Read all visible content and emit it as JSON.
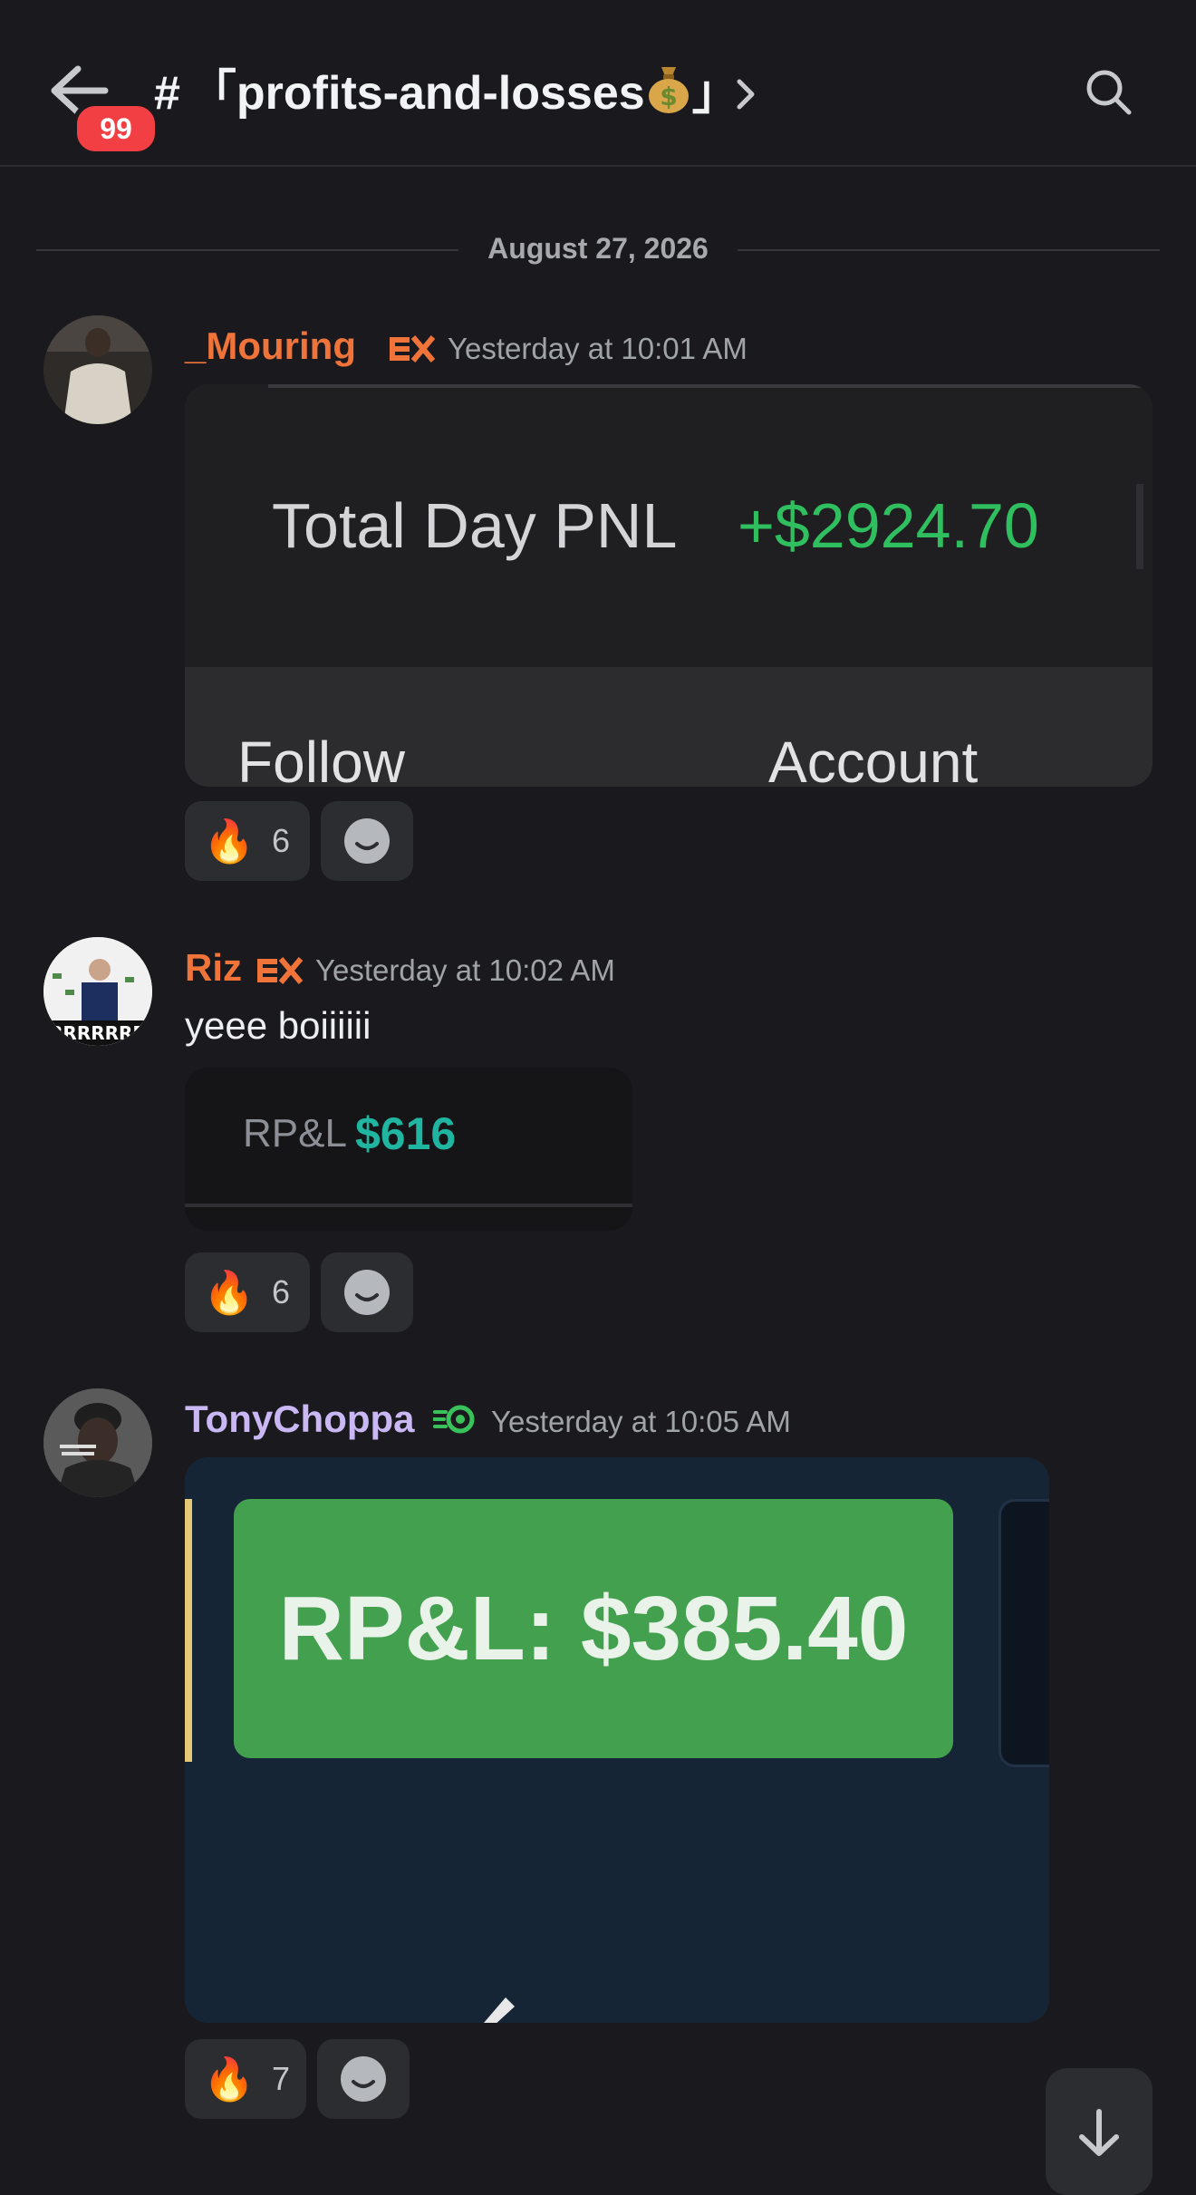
{
  "header": {
    "unread_badge": "99",
    "channel_hash": "#",
    "channel_name": "「profits-and-losses",
    "channel_suffix": "」"
  },
  "date_divider": "August 27, 2026",
  "messages": [
    {
      "author": "_Mouring",
      "author_color": "#f0743a",
      "tag": "EX",
      "timestamp": "Yesterday at 10:01 AM",
      "image": {
        "label": "Total Day PNL",
        "value": "+$2924.70",
        "footer_left": "Follow",
        "footer_right": "Account"
      },
      "reaction": {
        "emoji": "🔥",
        "count": "6"
      }
    },
    {
      "author": "Riz",
      "author_color": "#f0743a",
      "tag": "EX",
      "timestamp": "Yesterday at 10:02 AM",
      "text": "yeee boiiiiii",
      "image": {
        "label": "RP&L",
        "value": "$616"
      },
      "reaction": {
        "emoji": "🔥",
        "count": "6"
      }
    },
    {
      "author": "TonyChoppa",
      "author_color": "#c9b8f3",
      "timestamp": "Yesterday at 10:05 AM",
      "image": {
        "text": "RP&L: $385.40"
      },
      "reaction": {
        "emoji": "🔥",
        "count": "7"
      }
    }
  ],
  "colors": {
    "background": "#1a1a1e",
    "pnl_green": "#2fbf5f",
    "rpl_teal": "#1fb5a0",
    "rpl_card_green": "#43a04f"
  }
}
